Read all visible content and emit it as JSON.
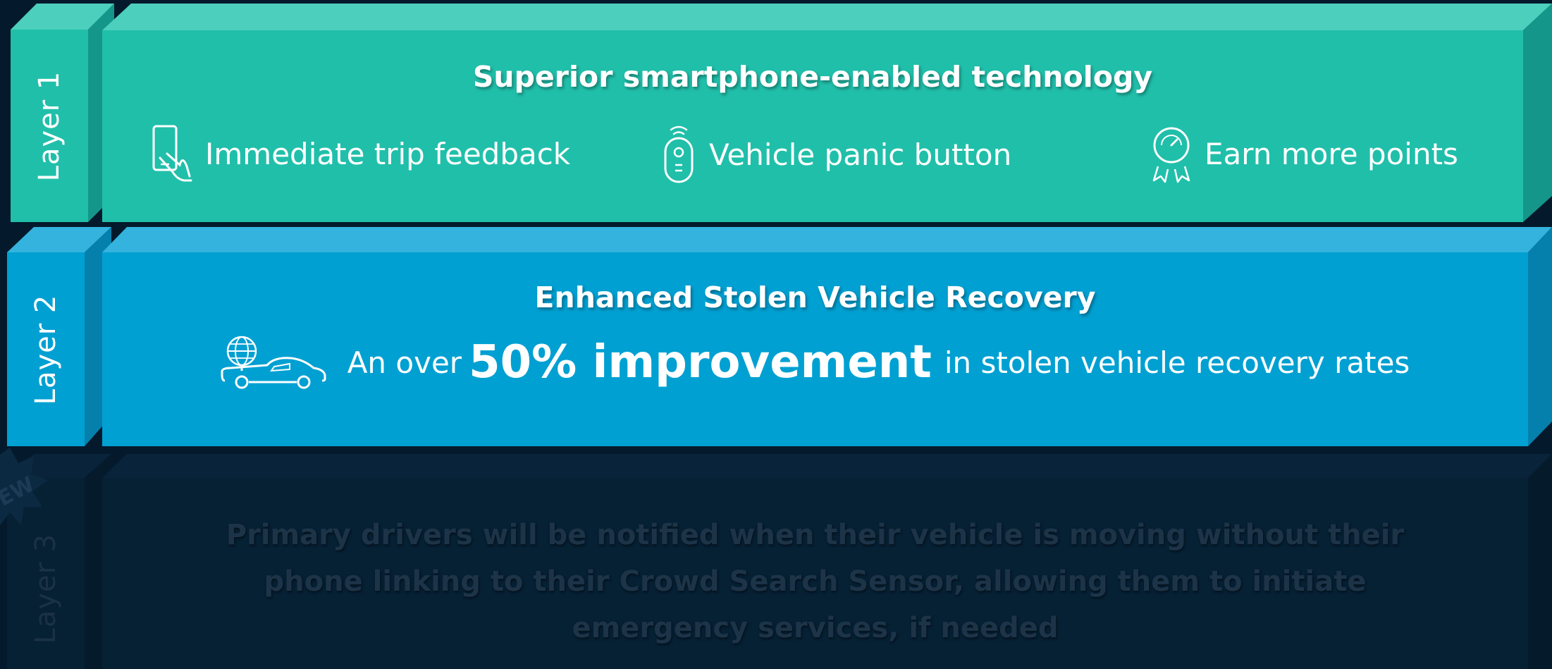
{
  "layers": [
    {
      "tab": "Layer 1",
      "title": "Superior smartphone-enabled technology",
      "features": [
        {
          "icon": "smartphone-hand-icon",
          "label": "Immediate trip feedback"
        },
        {
          "icon": "panic-remote-icon",
          "label": "Vehicle panic button"
        },
        {
          "icon": "award-gauge-icon",
          "label": "Earn more points"
        }
      ]
    },
    {
      "tab": "Layer 2",
      "title": "Enhanced Stolen Vehicle Recovery",
      "icon": "tracked-car-icon",
      "prefix": "An over",
      "highlight": "50% improvement",
      "suffix": "in stolen vehicle recovery rates"
    },
    {
      "tab": "Layer 3",
      "badge": "EW",
      "text": "Primary drivers will be notified when their vehicle is moving without their phone linking to their Crowd Search Sensor, allowing them to initiate emergency services, if needed"
    }
  ],
  "colors": {
    "background": "#041a2c",
    "layer1_face": "#20bfaa",
    "layer1_top": "#4ccfbd",
    "layer1_side": "#15968a",
    "layer2_face": "#00a0d2",
    "layer2_top": "#33b3dd",
    "layer2_side": "#0580ad",
    "layer3_face": "#062034",
    "layer3_text": "#1d3448"
  }
}
